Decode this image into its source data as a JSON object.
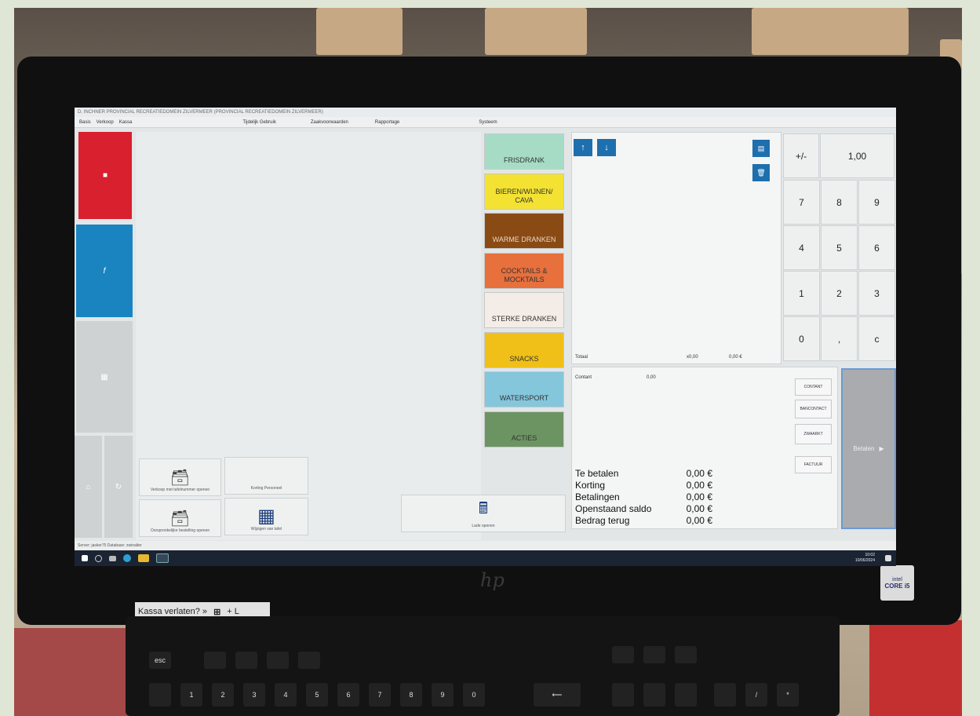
{
  "window": {
    "title": "D. INCHNER PROVINCIAL RECREATIEDOMEIN ZILVERMEER  (PROVINCIAL RECREATIEDOMEIN ZILVERMEER)"
  },
  "menu": [
    "Basis",
    "Verkoop",
    "Kassa",
    "Tijdelijk Gebruik",
    "Zaakvoorwaarden",
    "Rapportage",
    "Systeem"
  ],
  "categories": [
    {
      "label": "FRISDRANK",
      "color": "#a6dcc6"
    },
    {
      "label": "BIEREN/WIJNEN/\nCAVA",
      "color": "#f3e232"
    },
    {
      "label": "WARME DRANKEN",
      "color": "#8a4a14"
    },
    {
      "label": "COCKTAILS &\nMOCKTAILS",
      "color": "#e7703c"
    },
    {
      "label": "STERKE DRANKEN",
      "color": "#f4ece6"
    },
    {
      "label": "SNACKS",
      "color": "#f0c018"
    },
    {
      "label": "WATERSPORT",
      "color": "#84c6dc"
    },
    {
      "label": "ACTIES",
      "color": "#6c9462"
    }
  ],
  "order": {
    "total_label": "Totaal",
    "total_qty": "x0,00",
    "total_amount": "0,00 €"
  },
  "keypad": {
    "plusminus": "+/-",
    "display": "1,00",
    "keys": [
      "7",
      "8",
      "9",
      "4",
      "5",
      "6",
      "1",
      "2",
      "3",
      "0",
      ",",
      "c"
    ]
  },
  "payment": {
    "contant_label": "Contant",
    "contant_value": "0,00",
    "buttons": [
      "CONTANT",
      "BANCONTACT",
      "ZWAARKT",
      "FACTUUR"
    ],
    "betalen": "Betalen"
  },
  "totals": [
    {
      "label": "Te betalen",
      "value": "0,00 €"
    },
    {
      "label": "Korting",
      "value": "0,00 €"
    },
    {
      "label": "Betalingen",
      "value": "0,00 €"
    },
    {
      "label": "Openstaand saldo",
      "value": "0,00 €"
    },
    {
      "label": "Bedrag terug",
      "value": "0,00 €"
    }
  ],
  "tools": {
    "korting_personeel": "Korting Personeel",
    "lade_openen": "Lade openen",
    "verkoop_tafelnr": "Verkoop met tafelnummer openen",
    "oorspronkelijk": "Oorspronkelijke bestelling openen",
    "tafels": "Wijzigen van tafel"
  },
  "statusbar": {
    "left": "Server: jasker75 Database: zwinalter",
    "time": "10:02",
    "date": "10/06/2024"
  },
  "sticker": {
    "text": "Kassa verlaten? »",
    "suffix": "+ L"
  },
  "intel": {
    "brand": "intel",
    "model": "CORE i5"
  },
  "brand": "hp"
}
